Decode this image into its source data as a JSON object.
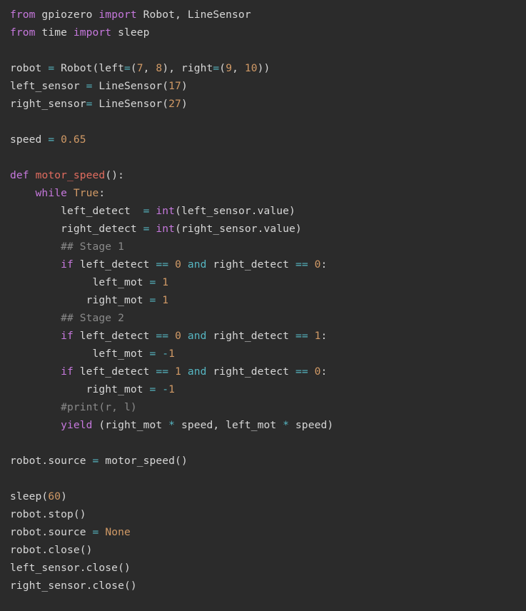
{
  "editor": {
    "language": "Python",
    "background_color": "#2b2b2b",
    "default_text_color": "#d7d7d7",
    "theme_colors": {
      "keyword": "#c678dd",
      "operator": "#56b6c2",
      "number": "#d19a66",
      "constant": "#d19a66",
      "function_name": "#e06c5f",
      "builtin": "#c678dd",
      "comment": "#8a8a8a",
      "plain": "#d7d7d7"
    }
  },
  "code": {
    "plain_text": "from gpiozero import Robot, LineSensor\nfrom time import sleep\n\nrobot = Robot(left=(7, 8), right=(9, 10))\nleft_sensor = LineSensor(17)\nright_sensor= LineSensor(27)\n\nspeed = 0.65\n\ndef motor_speed():\n    while True:\n        left_detect  = int(left_sensor.value)\n        right_detect = int(right_sensor.value)\n        ## Stage 1\n        if left_detect == 0 and right_detect == 0:\n             left_mot = 1\n            right_mot = 1\n        ## Stage 2\n        if left_detect == 0 and right_detect == 1:\n             left_mot = -1\n        if left_detect == 1 and right_detect == 0:\n            right_mot = -1\n        #print(r, l)\n        yield (right_mot * speed, left_mot * speed)\n\nrobot.source = motor_speed()\n\nsleep(60)\nrobot.stop()\nrobot.source = None\nrobot.close()\nleft_sensor.close()\nright_sensor.close()",
    "lines": [
      {
        "n": 1,
        "tokens": [
          {
            "t": "from",
            "c": "kw"
          },
          {
            "t": " gpiozero ",
            "c": "txt"
          },
          {
            "t": "import",
            "c": "kw"
          },
          {
            "t": " Robot, LineSensor",
            "c": "txt"
          }
        ]
      },
      {
        "n": 2,
        "tokens": [
          {
            "t": "from",
            "c": "kw"
          },
          {
            "t": " time ",
            "c": "txt"
          },
          {
            "t": "import",
            "c": "kw"
          },
          {
            "t": " sleep",
            "c": "txt"
          }
        ]
      },
      {
        "n": 3,
        "tokens": []
      },
      {
        "n": 4,
        "tokens": [
          {
            "t": "robot ",
            "c": "txt"
          },
          {
            "t": "=",
            "c": "op"
          },
          {
            "t": " Robot(left",
            "c": "txt"
          },
          {
            "t": "=",
            "c": "op"
          },
          {
            "t": "(",
            "c": "txt"
          },
          {
            "t": "7",
            "c": "num"
          },
          {
            "t": ", ",
            "c": "txt"
          },
          {
            "t": "8",
            "c": "num"
          },
          {
            "t": "), right",
            "c": "txt"
          },
          {
            "t": "=",
            "c": "op"
          },
          {
            "t": "(",
            "c": "txt"
          },
          {
            "t": "9",
            "c": "num"
          },
          {
            "t": ", ",
            "c": "txt"
          },
          {
            "t": "10",
            "c": "num"
          },
          {
            "t": "))",
            "c": "txt"
          }
        ]
      },
      {
        "n": 5,
        "tokens": [
          {
            "t": "left_sensor ",
            "c": "txt"
          },
          {
            "t": "=",
            "c": "op"
          },
          {
            "t": " LineSensor(",
            "c": "txt"
          },
          {
            "t": "17",
            "c": "num"
          },
          {
            "t": ")",
            "c": "txt"
          }
        ]
      },
      {
        "n": 6,
        "tokens": [
          {
            "t": "right_sensor",
            "c": "txt"
          },
          {
            "t": "=",
            "c": "op"
          },
          {
            "t": " LineSensor(",
            "c": "txt"
          },
          {
            "t": "27",
            "c": "num"
          },
          {
            "t": ")",
            "c": "txt"
          }
        ]
      },
      {
        "n": 7,
        "tokens": []
      },
      {
        "n": 8,
        "tokens": [
          {
            "t": "speed ",
            "c": "txt"
          },
          {
            "t": "=",
            "c": "op"
          },
          {
            "t": " ",
            "c": "txt"
          },
          {
            "t": "0.65",
            "c": "num"
          }
        ]
      },
      {
        "n": 9,
        "tokens": []
      },
      {
        "n": 10,
        "tokens": [
          {
            "t": "def",
            "c": "kw"
          },
          {
            "t": " ",
            "c": "txt"
          },
          {
            "t": "motor_speed",
            "c": "fn"
          },
          {
            "t": "():",
            "c": "txt"
          }
        ]
      },
      {
        "n": 11,
        "tokens": [
          {
            "t": "    ",
            "c": "txt"
          },
          {
            "t": "while",
            "c": "kw"
          },
          {
            "t": " ",
            "c": "txt"
          },
          {
            "t": "True",
            "c": "const"
          },
          {
            "t": ":",
            "c": "txt"
          }
        ]
      },
      {
        "n": 12,
        "tokens": [
          {
            "t": "        left_detect  ",
            "c": "txt"
          },
          {
            "t": "=",
            "c": "op"
          },
          {
            "t": " ",
            "c": "txt"
          },
          {
            "t": "int",
            "c": "builtin"
          },
          {
            "t": "(left_sensor.value)",
            "c": "txt"
          }
        ]
      },
      {
        "n": 13,
        "tokens": [
          {
            "t": "        right_detect ",
            "c": "txt"
          },
          {
            "t": "=",
            "c": "op"
          },
          {
            "t": " ",
            "c": "txt"
          },
          {
            "t": "int",
            "c": "builtin"
          },
          {
            "t": "(right_sensor.value)",
            "c": "txt"
          }
        ]
      },
      {
        "n": 14,
        "tokens": [
          {
            "t": "        ",
            "c": "txt"
          },
          {
            "t": "## Stage 1",
            "c": "cmt"
          }
        ]
      },
      {
        "n": 15,
        "tokens": [
          {
            "t": "        ",
            "c": "txt"
          },
          {
            "t": "if",
            "c": "kw"
          },
          {
            "t": " left_detect ",
            "c": "txt"
          },
          {
            "t": "==",
            "c": "op"
          },
          {
            "t": " ",
            "c": "txt"
          },
          {
            "t": "0",
            "c": "num"
          },
          {
            "t": " ",
            "c": "txt"
          },
          {
            "t": "and",
            "c": "op"
          },
          {
            "t": " right_detect ",
            "c": "txt"
          },
          {
            "t": "==",
            "c": "op"
          },
          {
            "t": " ",
            "c": "txt"
          },
          {
            "t": "0",
            "c": "num"
          },
          {
            "t": ":",
            "c": "txt"
          }
        ]
      },
      {
        "n": 16,
        "tokens": [
          {
            "t": "             left_mot ",
            "c": "txt"
          },
          {
            "t": "=",
            "c": "op"
          },
          {
            "t": " ",
            "c": "txt"
          },
          {
            "t": "1",
            "c": "num"
          }
        ]
      },
      {
        "n": 17,
        "tokens": [
          {
            "t": "            right_mot ",
            "c": "txt"
          },
          {
            "t": "=",
            "c": "op"
          },
          {
            "t": " ",
            "c": "txt"
          },
          {
            "t": "1",
            "c": "num"
          }
        ]
      },
      {
        "n": 18,
        "tokens": [
          {
            "t": "        ",
            "c": "txt"
          },
          {
            "t": "## Stage 2",
            "c": "cmt"
          }
        ]
      },
      {
        "n": 19,
        "tokens": [
          {
            "t": "        ",
            "c": "txt"
          },
          {
            "t": "if",
            "c": "kw"
          },
          {
            "t": " left_detect ",
            "c": "txt"
          },
          {
            "t": "==",
            "c": "op"
          },
          {
            "t": " ",
            "c": "txt"
          },
          {
            "t": "0",
            "c": "num"
          },
          {
            "t": " ",
            "c": "txt"
          },
          {
            "t": "and",
            "c": "op"
          },
          {
            "t": " right_detect ",
            "c": "txt"
          },
          {
            "t": "==",
            "c": "op"
          },
          {
            "t": " ",
            "c": "txt"
          },
          {
            "t": "1",
            "c": "num"
          },
          {
            "t": ":",
            "c": "txt"
          }
        ]
      },
      {
        "n": 20,
        "tokens": [
          {
            "t": "             left_mot ",
            "c": "txt"
          },
          {
            "t": "=",
            "c": "op"
          },
          {
            "t": " ",
            "c": "txt"
          },
          {
            "t": "-",
            "c": "op"
          },
          {
            "t": "1",
            "c": "num"
          }
        ]
      },
      {
        "n": 21,
        "tokens": [
          {
            "t": "        ",
            "c": "txt"
          },
          {
            "t": "if",
            "c": "kw"
          },
          {
            "t": " left_detect ",
            "c": "txt"
          },
          {
            "t": "==",
            "c": "op"
          },
          {
            "t": " ",
            "c": "txt"
          },
          {
            "t": "1",
            "c": "num"
          },
          {
            "t": " ",
            "c": "txt"
          },
          {
            "t": "and",
            "c": "op"
          },
          {
            "t": " right_detect ",
            "c": "txt"
          },
          {
            "t": "==",
            "c": "op"
          },
          {
            "t": " ",
            "c": "txt"
          },
          {
            "t": "0",
            "c": "num"
          },
          {
            "t": ":",
            "c": "txt"
          }
        ]
      },
      {
        "n": 22,
        "tokens": [
          {
            "t": "            right_mot ",
            "c": "txt"
          },
          {
            "t": "=",
            "c": "op"
          },
          {
            "t": " ",
            "c": "txt"
          },
          {
            "t": "-",
            "c": "op"
          },
          {
            "t": "1",
            "c": "num"
          }
        ]
      },
      {
        "n": 23,
        "tokens": [
          {
            "t": "        ",
            "c": "txt"
          },
          {
            "t": "#print(r, l)",
            "c": "cmt"
          }
        ]
      },
      {
        "n": 24,
        "tokens": [
          {
            "t": "        ",
            "c": "txt"
          },
          {
            "t": "yield",
            "c": "kw"
          },
          {
            "t": " (right_mot ",
            "c": "txt"
          },
          {
            "t": "*",
            "c": "op"
          },
          {
            "t": " speed, left_mot ",
            "c": "txt"
          },
          {
            "t": "*",
            "c": "op"
          },
          {
            "t": " speed)",
            "c": "txt"
          }
        ]
      },
      {
        "n": 25,
        "tokens": []
      },
      {
        "n": 26,
        "tokens": [
          {
            "t": "robot.source ",
            "c": "txt"
          },
          {
            "t": "=",
            "c": "op"
          },
          {
            "t": " motor_speed()",
            "c": "txt"
          }
        ]
      },
      {
        "n": 27,
        "tokens": []
      },
      {
        "n": 28,
        "tokens": [
          {
            "t": "sleep(",
            "c": "txt"
          },
          {
            "t": "60",
            "c": "num"
          },
          {
            "t": ")",
            "c": "txt"
          }
        ]
      },
      {
        "n": 29,
        "tokens": [
          {
            "t": "robot.stop()",
            "c": "txt"
          }
        ]
      },
      {
        "n": 30,
        "tokens": [
          {
            "t": "robot.source ",
            "c": "txt"
          },
          {
            "t": "=",
            "c": "op"
          },
          {
            "t": " ",
            "c": "txt"
          },
          {
            "t": "None",
            "c": "const"
          }
        ]
      },
      {
        "n": 31,
        "tokens": [
          {
            "t": "robot.close()",
            "c": "txt"
          }
        ]
      },
      {
        "n": 32,
        "tokens": [
          {
            "t": "left_sensor.close()",
            "c": "txt"
          }
        ]
      },
      {
        "n": 33,
        "tokens": [
          {
            "t": "right_sensor.close()",
            "c": "txt"
          }
        ]
      }
    ]
  }
}
